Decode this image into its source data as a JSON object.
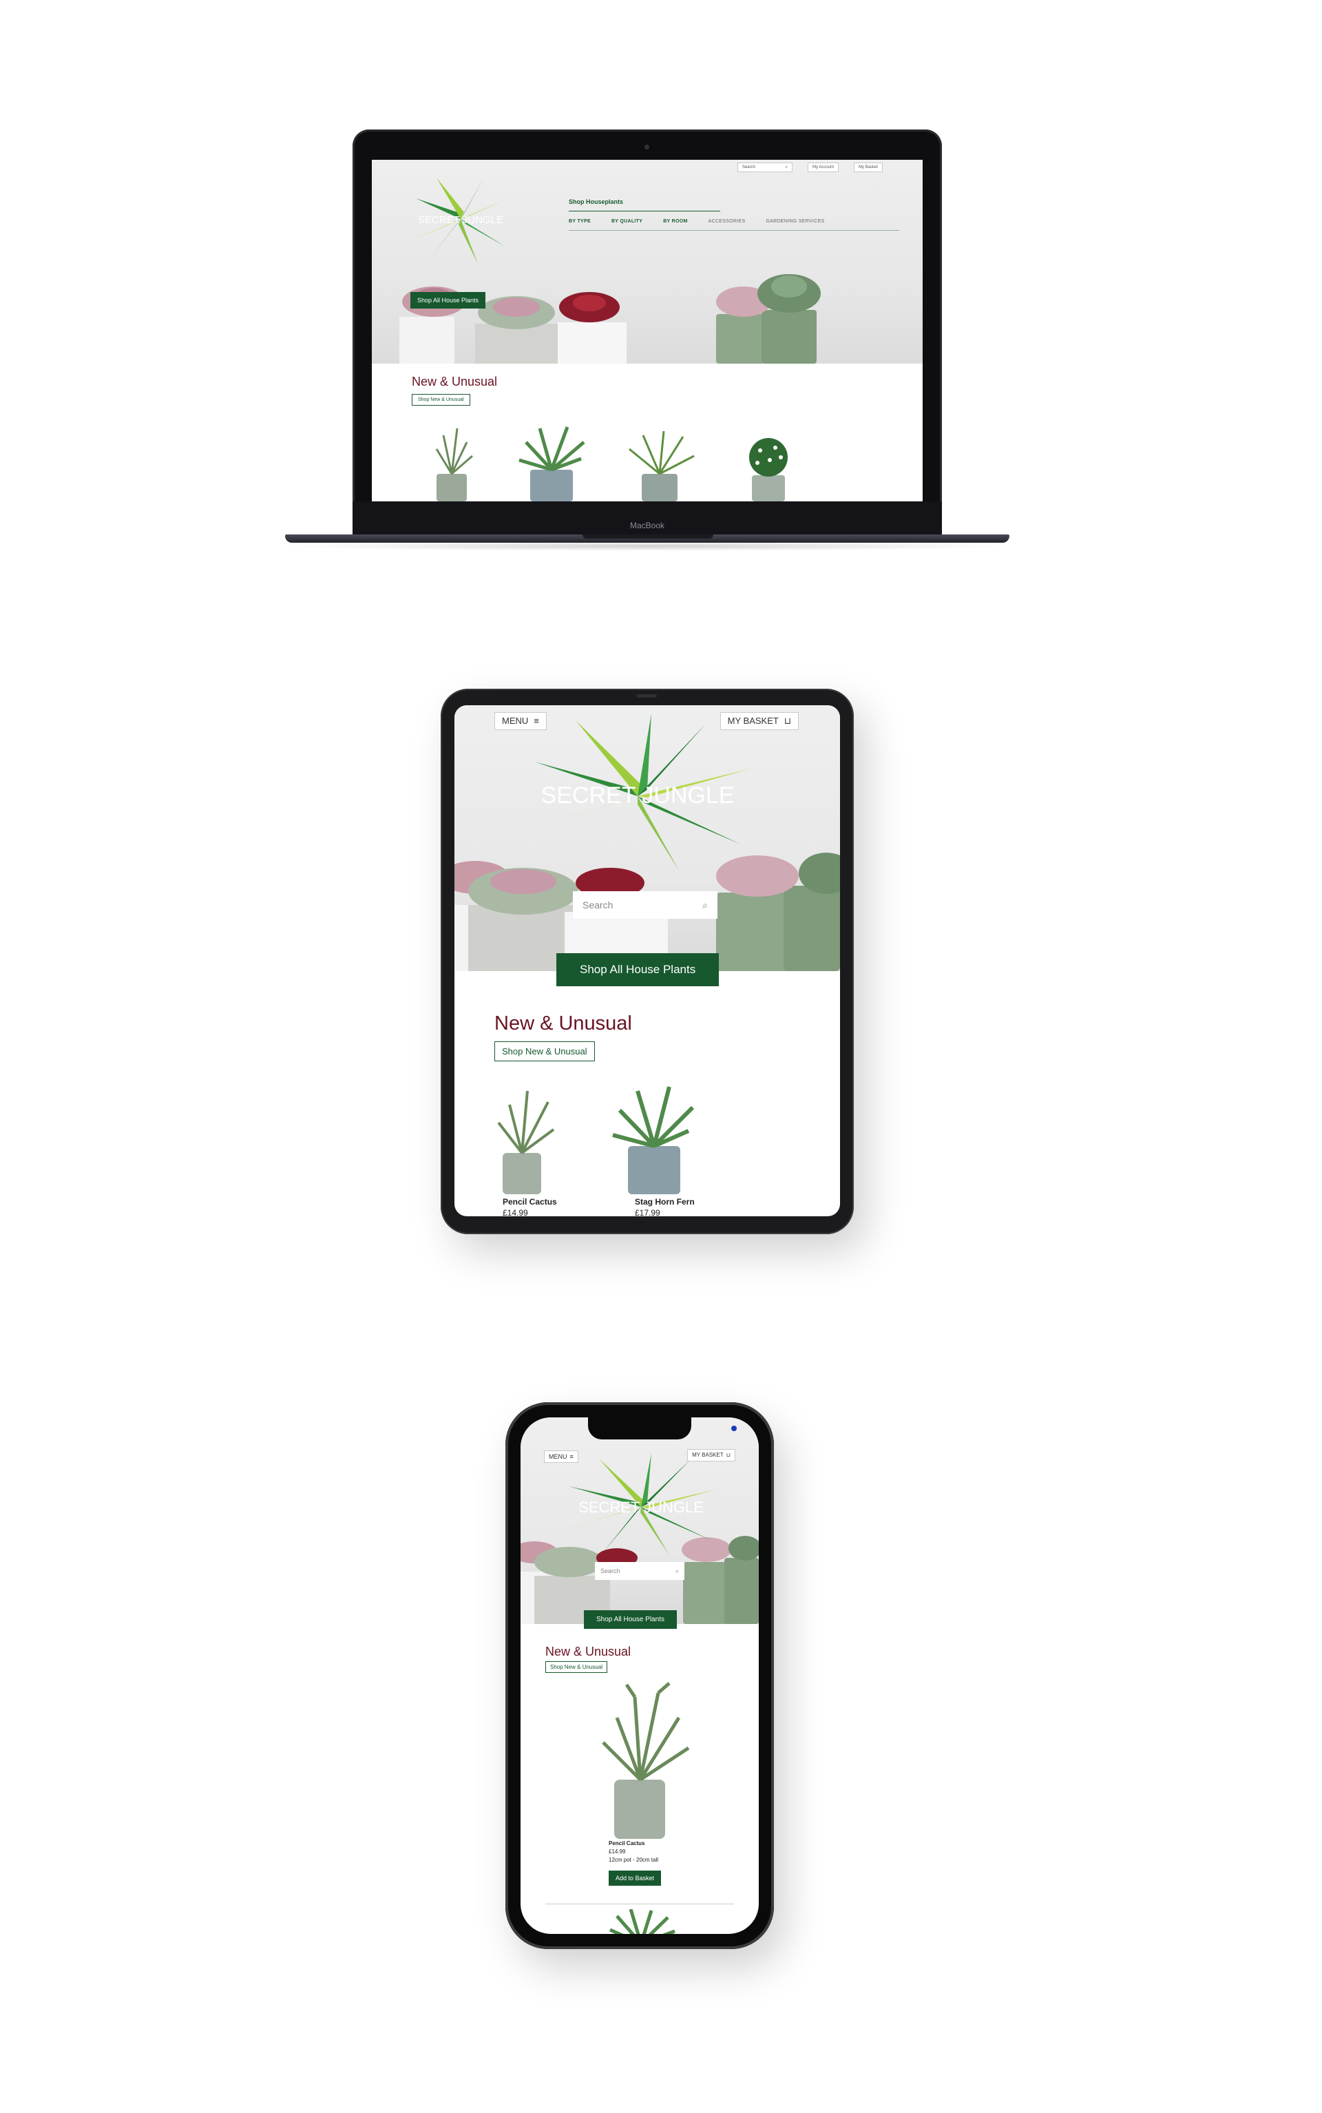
{
  "laptop": {
    "brand": "MacBook",
    "header": {
      "search_placeholder": "Search",
      "account_label": "My Account",
      "basket_label": "My Basket"
    },
    "logo_text": "SECRET JUNGLE",
    "nav_heading": "Shop Houseplants",
    "nav_items": [
      "BY TYPE",
      "BY QUALITY",
      "BY ROOM",
      "ACCESSORIES",
      "GARDENING SERVICES"
    ],
    "hero_button": "Shop All House Plants",
    "section_title": "New & Unusual",
    "section_button": "Shop New & Unusual"
  },
  "tablet": {
    "menu_label": "MENU",
    "basket_label": "MY BASKET",
    "logo_text": "SECRET JUNGLE",
    "search_placeholder": "Search",
    "hero_button": "Shop All House Plants",
    "section_title": "New & Unusual",
    "section_button": "Shop New & Unusual",
    "products": [
      {
        "name": "Pencil Cactus",
        "price": "£14.99"
      },
      {
        "name": "Stag Horn Fern",
        "price": "£17.99"
      }
    ]
  },
  "phone": {
    "menu_label": "MENU",
    "basket_label": "MY BASKET",
    "logo_text": "SECRET JUNGLE",
    "search_placeholder": "Search",
    "hero_button": "Shop All House Plants",
    "section_title": "New & Unusual",
    "section_button": "Shop New & Unusual",
    "product": {
      "name": "Pencil Cactus",
      "price": "£14.99",
      "description": "12cm pot - 20cm tall",
      "add_button": "Add to Basket"
    }
  },
  "colors": {
    "brand_green": "#17582e",
    "heading_maroon": "#6a1322",
    "leaf_light": "#9ccc3c",
    "leaf_dark": "#1f7a34"
  },
  "icons": [
    "search-icon",
    "hamburger-icon",
    "basket-icon"
  ]
}
